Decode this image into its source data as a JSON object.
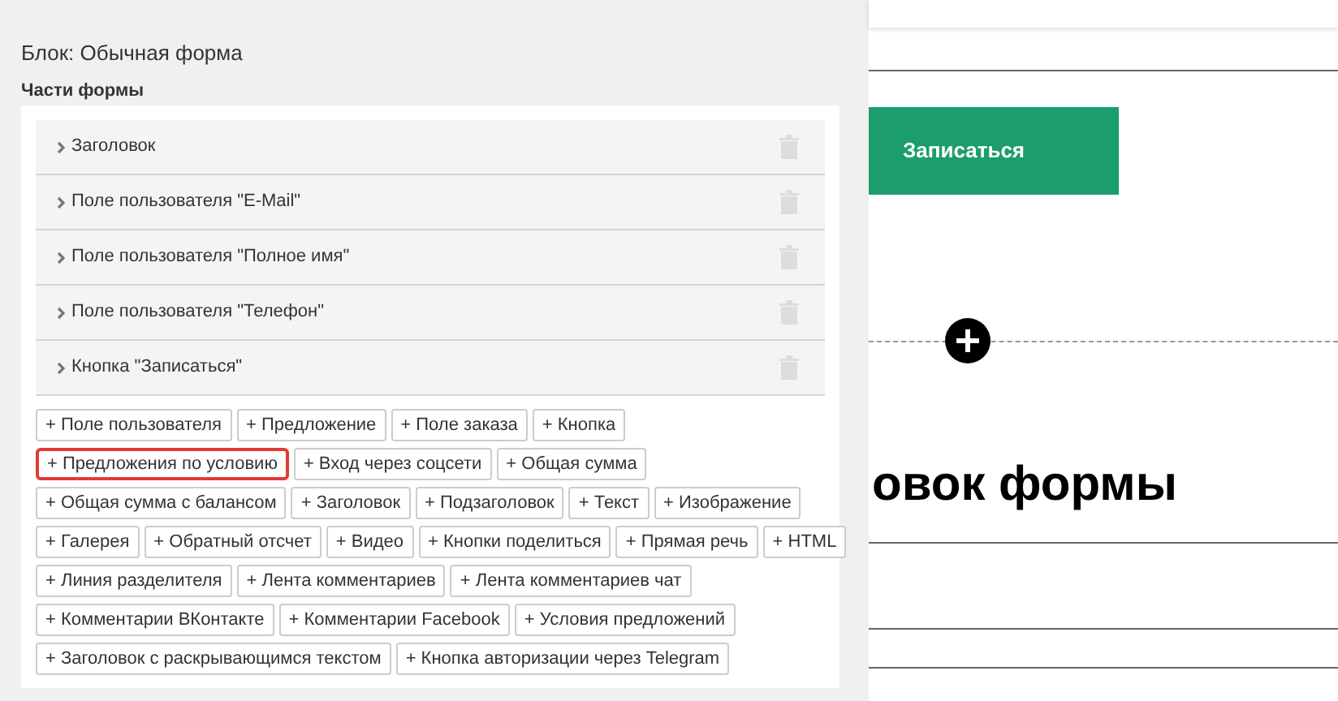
{
  "panel": {
    "title": "Блок: Обычная форма",
    "section_label": "Части формы",
    "parts": [
      {
        "label": "Заголовок"
      },
      {
        "label": "Поле пользователя \"E-Mail\""
      },
      {
        "label": "Поле пользователя \"Полное имя\""
      },
      {
        "label": "Поле пользователя \"Телефон\""
      },
      {
        "label": "Кнопка \"Записаться\""
      }
    ],
    "add_buttons": [
      [
        {
          "label": "+ Поле пользователя",
          "selected": false
        },
        {
          "label": "+ Предложение",
          "selected": false
        },
        {
          "label": "+ Поле заказа",
          "selected": false
        },
        {
          "label": "+ Кнопка",
          "selected": false
        }
      ],
      [
        {
          "label": "+ Предложения по условию",
          "selected": true
        },
        {
          "label": "+ Вход через соцсети",
          "selected": false
        },
        {
          "label": "+ Общая сумма",
          "selected": false
        }
      ],
      [
        {
          "label": "+ Общая сумма с балансом",
          "selected": false
        },
        {
          "label": "+ Заголовок",
          "selected": false
        },
        {
          "label": "+ Подзаголовок",
          "selected": false
        },
        {
          "label": "+ Текст",
          "selected": false
        },
        {
          "label": "+ Изображение",
          "selected": false
        }
      ],
      [
        {
          "label": "+ Галерея",
          "selected": false
        },
        {
          "label": "+ Обратный отсчет",
          "selected": false
        },
        {
          "label": "+ Видео",
          "selected": false
        },
        {
          "label": "+ Кнопки поделиться",
          "selected": false
        },
        {
          "label": "+ Прямая речь",
          "selected": false
        },
        {
          "label": "+ HTML",
          "selected": false
        }
      ],
      [
        {
          "label": "+ Линия разделителя",
          "selected": false
        },
        {
          "label": "+ Лента комментариев",
          "selected": false
        },
        {
          "label": "+ Лента комментариев чат",
          "selected": false
        }
      ],
      [
        {
          "label": "+ Комментарии ВКонтакте",
          "selected": false
        },
        {
          "label": "+ Комментарии Facebook",
          "selected": false
        },
        {
          "label": "+ Условия предложений",
          "selected": false
        }
      ],
      [
        {
          "label": "+ Заголовок с раскрывающимся текстом",
          "selected": false
        },
        {
          "label": "+ Кнопка авторизации через Telegram",
          "selected": false
        }
      ]
    ]
  },
  "preview": {
    "submit_button": "Записаться",
    "heading": "овок формы"
  }
}
